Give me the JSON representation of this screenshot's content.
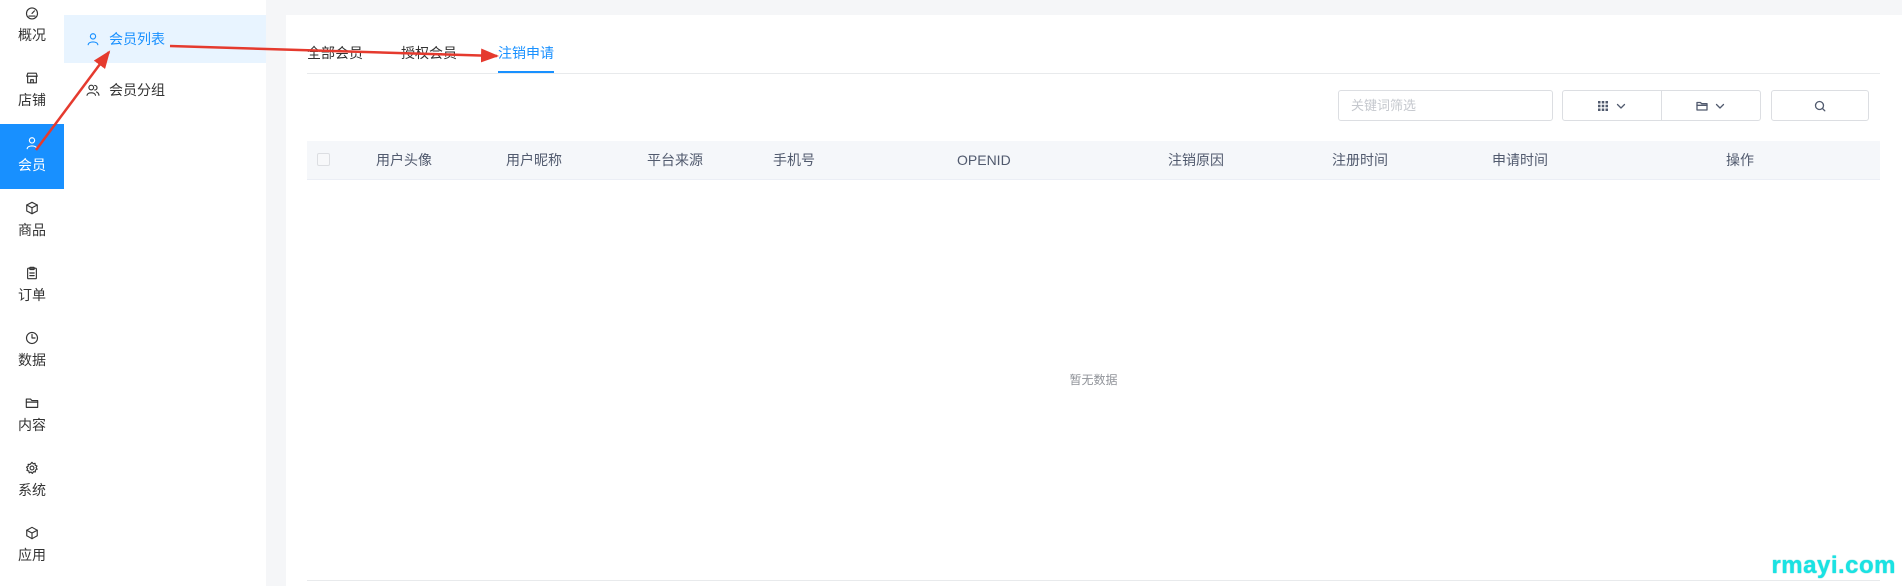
{
  "sidebar": {
    "items": [
      {
        "label": "概况",
        "icon": "dashboard-icon"
      },
      {
        "label": "店铺",
        "icon": "store-icon"
      },
      {
        "label": "会员",
        "icon": "user-icon",
        "active": true
      },
      {
        "label": "商品",
        "icon": "package-icon"
      },
      {
        "label": "订单",
        "icon": "clipboard-icon"
      },
      {
        "label": "数据",
        "icon": "clock-icon"
      },
      {
        "label": "内容",
        "icon": "folder-icon"
      },
      {
        "label": "系统",
        "icon": "gear-icon"
      },
      {
        "label": "应用",
        "icon": "cube-icon"
      }
    ]
  },
  "subnav": {
    "items": [
      {
        "label": "会员列表",
        "icon": "user-icon",
        "active": true
      },
      {
        "label": "会员分组",
        "icon": "users-icon"
      }
    ]
  },
  "tabs": [
    {
      "label": "全部会员"
    },
    {
      "label": "授权会员"
    },
    {
      "label": "注销申请",
      "active": true
    }
  ],
  "filter": {
    "keyword_placeholder": "关键词筛选",
    "buttons": [
      {
        "icon": "grid-icon",
        "dropdown": true
      },
      {
        "icon": "folder-icon",
        "dropdown": true
      },
      {
        "icon": "search-icon"
      }
    ]
  },
  "table": {
    "columns": [
      "用户头像",
      "用户昵称",
      "平台来源",
      "手机号",
      "OPENID",
      "注销原因",
      "注册时间",
      "申请时间",
      "操作"
    ],
    "empty_text": "暂无数据"
  },
  "watermark": "rmayi.com",
  "colors": {
    "accent": "#1890ff",
    "accent_light": "#e8f4ff",
    "annotation": "#e53a2e",
    "watermark": "#19e3e3"
  }
}
